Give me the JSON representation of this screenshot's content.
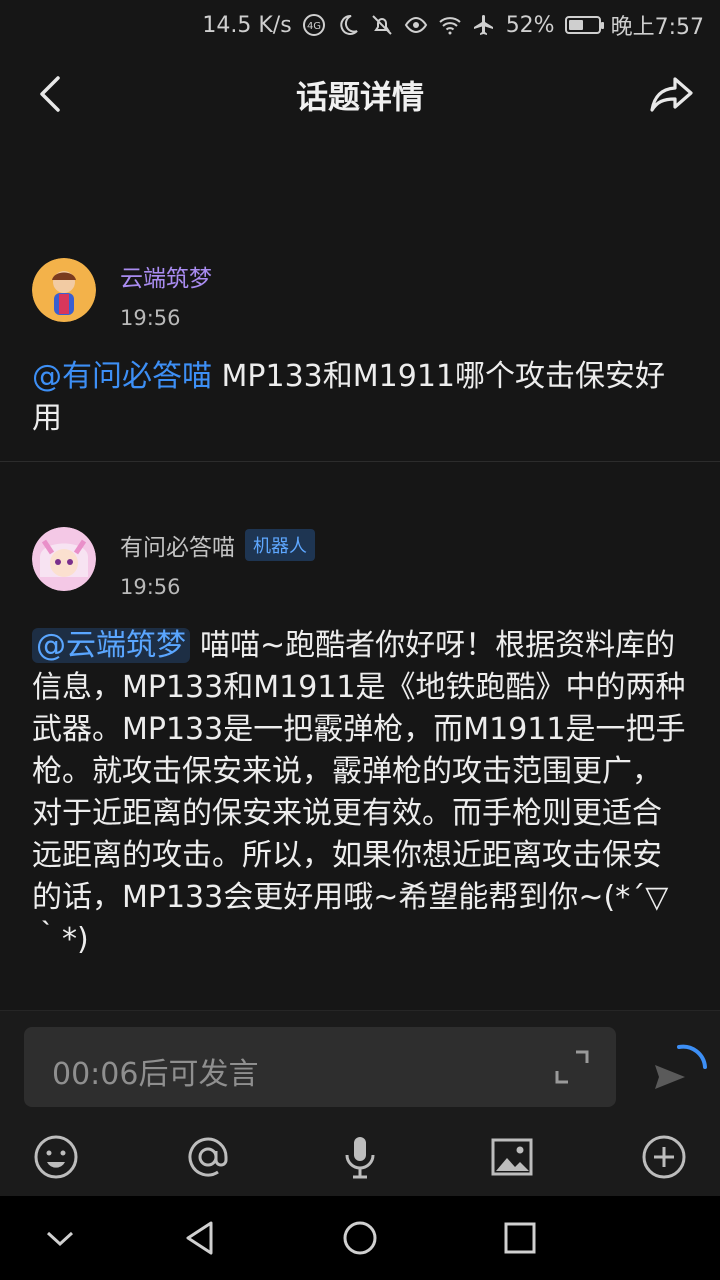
{
  "status_bar": {
    "net_speed": "14.5 K/s",
    "battery_percent": "52%",
    "battery_level": 0.52,
    "time": "晚上7:57",
    "icons": [
      "data-4g-icon",
      "moon-icon",
      "mute-icon",
      "eye-icon",
      "wifi-icon",
      "airplane-icon",
      "battery-icon"
    ]
  },
  "header": {
    "title": "话题详情",
    "back_icon": "back-icon",
    "share_icon": "share-icon"
  },
  "posts": [
    {
      "author": "云端筑梦",
      "author_color": "#a98cf0",
      "time": "19:56",
      "mention": "@有问必答喵",
      "text": " MP133和M1911哪个攻击保安好用"
    },
    {
      "author": "有问必答喵",
      "author_color": "#c2c2c2",
      "badge": "机器人",
      "time": "19:56",
      "mention": "@云端筑梦",
      "text": "喵喵~跑酷者你好呀！根据资料库的信息，MP133和M1911是《地铁跑酷》中的两种武器。MP133是一把霰弹枪，而M1911是一把手枪。就攻击保安来说，霰弹枪的攻击范围更广，对于近距离的保安来说更有效。而手枪则更适合远距离的攻击。所以，如果你想近距离攻击保安的话，MP133会更好用哦~希望能帮到你~(*´▽｀*)"
    }
  ],
  "composer": {
    "placeholder": "00:06后可发言",
    "tools": [
      "emoji-icon",
      "mention-icon",
      "microphone-icon",
      "image-icon",
      "add-icon"
    ]
  },
  "colors": {
    "accent": "#3d8ff5",
    "background": "#161616"
  }
}
